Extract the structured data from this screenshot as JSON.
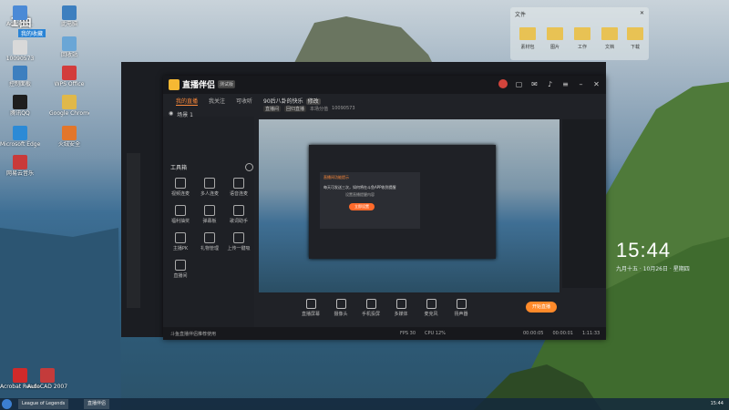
{
  "desktop": {
    "corner_brand": "1曲",
    "corner_badge": "我的收藏",
    "icons": [
      {
        "label": "Adminis...",
        "color": "#4b8ad6"
      },
      {
        "label": "此电脑",
        "color": "#3d7fbf"
      },
      {
        "label": "10090573",
        "color": "#d9d9d9"
      },
      {
        "label": "回收站",
        "color": "#6aa6d6"
      },
      {
        "label": "控制面板",
        "color": "#3d7fbf"
      },
      {
        "label": "WPS Office",
        "color": "#d23c3c"
      },
      {
        "label": "腾讯QQ",
        "color": "#1e1e1e"
      },
      {
        "label": "Google Chrome",
        "color": "#e0b84a"
      },
      {
        "label": "Microsoft Edge",
        "color": "#2c8ad6"
      },
      {
        "label": "火绒安全",
        "color": "#e2762b"
      },
      {
        "label": "网易云音乐",
        "color": "#c93a3a"
      },
      {
        "label": "Acrobat Reader DC",
        "color": "#d02a2a"
      },
      {
        "label": "AutoCAD 2007",
        "color": "#c43b3b"
      }
    ]
  },
  "files_panel": {
    "title": "文件",
    "items": [
      "素材包",
      "图片",
      "工作",
      "文档",
      "下载"
    ]
  },
  "clock": {
    "time": "15:44",
    "date": "九月十五 · 10月26日 · 星期四"
  },
  "app": {
    "name": "直播伴侣",
    "tag": "测试版",
    "tabs": [
      {
        "label": "我的直播",
        "active": true
      },
      {
        "label": "我关注",
        "active": false
      },
      {
        "label": "可收听",
        "active": false
      }
    ],
    "room_title": "90后八卦的快乐",
    "room_badge": "修改",
    "room_meta": [
      "直播间",
      "回归直播",
      "本场分值",
      "10090573"
    ],
    "scene_label": "场景 1",
    "tools_title": "工具箱",
    "tools": [
      {
        "label": "视频连麦"
      },
      {
        "label": "多人连麦"
      },
      {
        "label": "语音连麦"
      },
      {
        "label": "福利抽奖"
      },
      {
        "label": "弹幕板"
      },
      {
        "label": "歌词助手"
      },
      {
        "label": "主播PK"
      },
      {
        "label": "礼物管理"
      },
      {
        "label": "上传一键吸"
      },
      {
        "label": "直播间"
      }
    ],
    "bottom_tools": [
      {
        "label": "直播屏幕"
      },
      {
        "label": "摄像头"
      },
      {
        "label": "手机投屏"
      },
      {
        "label": "多媒体"
      },
      {
        "label": "麦克风"
      },
      {
        "label": "扬声器"
      }
    ],
    "start_label": "开始直播",
    "status_left": "斗鱼直播伴侣推荐使用",
    "status_mid": [
      "FPS 30",
      "CPU 12%"
    ],
    "status_right": [
      "00:00:05",
      "00:00:01",
      "1:11:33"
    ],
    "dialog": {
      "title": "直播间功能提示",
      "body": "每天可发送三次，如何将在斗鱼APP收到提醒",
      "sub": "设置直播提醒内容",
      "button": "立即设置"
    }
  },
  "taskbar": {
    "tasks": [
      "League of Legends",
      "直播伴侣"
    ],
    "tray_time": "15:44"
  }
}
